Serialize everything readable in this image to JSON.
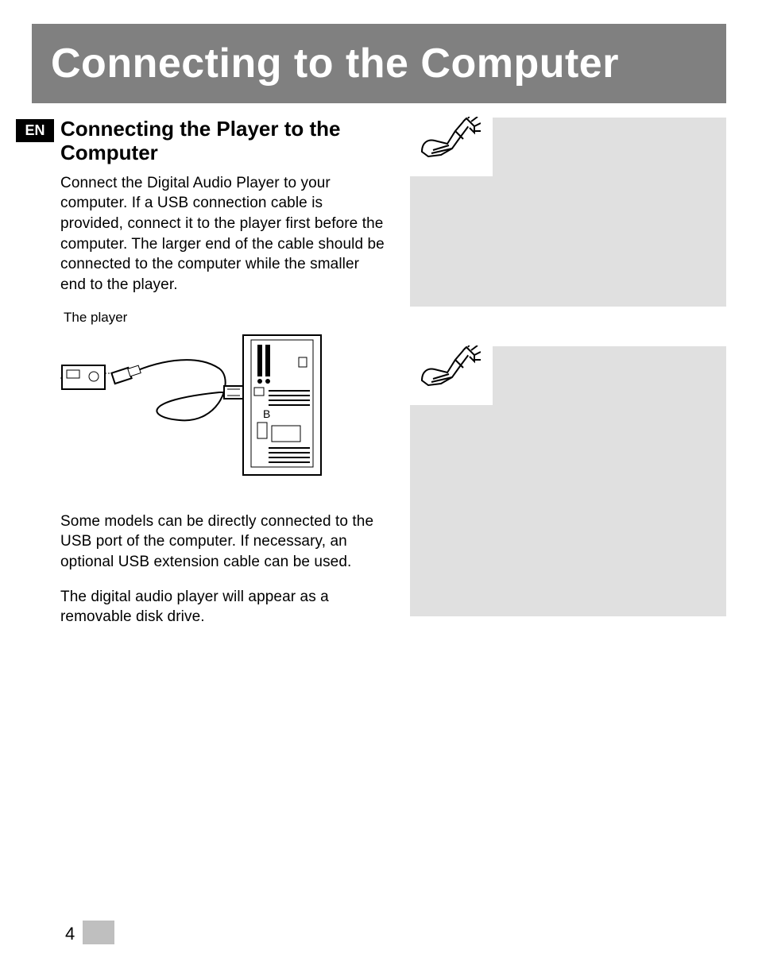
{
  "banner_title": "Connecting to the Computer",
  "language_badge": "EN",
  "section_heading": "Connecting the Player to the Computer",
  "paragraphs": {
    "intro": "Connect the Digital Audio Player to your computer. If a USB connection cable is provided, connect it to the player first before the computer. The larger end of the cable should be connected to the computer while the smaller end to the player.",
    "direct_connect": "Some models can be directly connected to the USB port of the computer. If necessary, an optional USB extension cable can be used.",
    "removable_disk": "The digital audio player will appear as a removable disk drive."
  },
  "figure_caption": "The player",
  "notes": {
    "note1": "",
    "note2": ""
  },
  "page_number": "4"
}
